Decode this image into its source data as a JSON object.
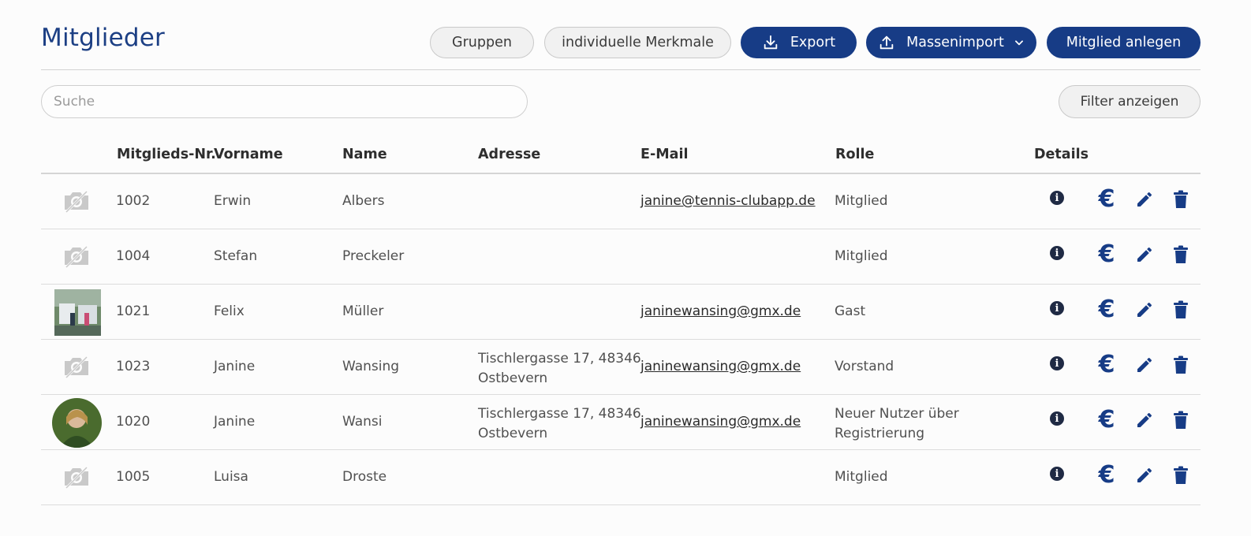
{
  "page": {
    "title": "Mitglieder"
  },
  "toolbar": {
    "groups_label": "Gruppen",
    "custom_attributes_label": "individuelle Merkmale",
    "export_label": "Export",
    "mass_import_label": "Massenimport",
    "create_member_label": "Mitglied anlegen"
  },
  "search": {
    "placeholder": "Suche",
    "value": ""
  },
  "filter": {
    "label": "Filter anzeigen"
  },
  "table": {
    "headers": {
      "number": "Mitglieds-Nr.",
      "firstname": "Vorname",
      "lastname": "Name",
      "address": "Adresse",
      "email": "E-Mail",
      "role": "Rolle",
      "details": "Details"
    },
    "rows": [
      {
        "photo": "placeholder",
        "number": "1002",
        "firstname": "Erwin",
        "lastname": "Albers",
        "address_line1": "",
        "address_line2": "",
        "email": "janine@tennis-clubapp.de",
        "role_line1": "Mitglied",
        "role_line2": ""
      },
      {
        "photo": "placeholder",
        "number": "1004",
        "firstname": "Stefan",
        "lastname": "Preckeler",
        "address_line1": "",
        "address_line2": "",
        "email": "",
        "role_line1": "Mitglied",
        "role_line2": ""
      },
      {
        "photo": "thumbnail",
        "number": "1021",
        "firstname": "Felix",
        "lastname": "Müller",
        "address_line1": "",
        "address_line2": "",
        "email": "janinewansing@gmx.de",
        "role_line1": "Gast",
        "role_line2": ""
      },
      {
        "photo": "placeholder",
        "number": "1023",
        "firstname": "Janine",
        "lastname": "Wansing",
        "address_line1": "Tischlergasse 17, 48346",
        "address_line2": "Ostbevern",
        "email": "janinewansing@gmx.de",
        "role_line1": "Vorstand",
        "role_line2": ""
      },
      {
        "photo": "avatar",
        "number": "1020",
        "firstname": "Janine",
        "lastname": "Wansi",
        "address_line1": "Tischlergasse 17, 48346",
        "address_line2": "Ostbevern",
        "email": "janinewansing@gmx.de",
        "role_line1": "Neuer Nutzer über",
        "role_line2": "Registrierung"
      },
      {
        "photo": "placeholder",
        "number": "1005",
        "firstname": "Luisa",
        "lastname": "Droste",
        "address_line1": "",
        "address_line2": "",
        "email": "",
        "role_line1": "Mitglied",
        "role_line2": ""
      }
    ]
  },
  "icons": {
    "export": "download-icon",
    "mass_import": "upload-icon",
    "dropdown": "chevron-down-icon",
    "no_photo": "camera-off-icon",
    "info": "info-icon",
    "payment": "euro-icon",
    "edit": "pencil-icon",
    "delete": "trash-icon"
  },
  "colors": {
    "primary": "#173c86",
    "title": "#1c3f84",
    "info_icon": "#1f2a44",
    "placeholder_icon": "#c8c8c8"
  }
}
